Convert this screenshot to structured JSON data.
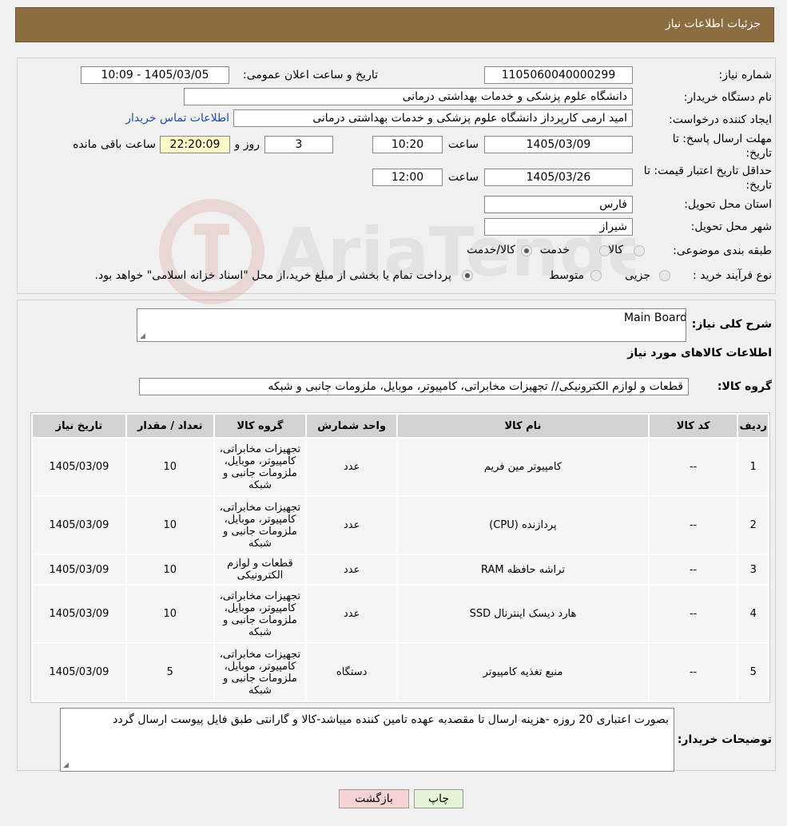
{
  "header": {
    "title": "جزئیات اطلاعات نیاز"
  },
  "details": {
    "need_number_label": "شماره نیاز:",
    "need_number": "1105060040000299",
    "announce_label": "تاریخ و ساعت اعلان عمومی:",
    "announce_value": "1405/03/05 - 10:09",
    "buyer_org_label": "نام دستگاه خریدار:",
    "buyer_org": "دانشگاه علوم پزشکی و خدمات بهداشتی درمانی",
    "creator_label": "ایجاد کننده درخواست:",
    "creator": "امید  ارمی کارپرداز دانشگاه علوم پزشکی و خدمات بهداشتی درمانی",
    "contact_link": "اطلاعات تماس خریدار",
    "deadline_label_1": "مهلت ارسال پاسخ: تا",
    "deadline_label_2": "تاریخ:",
    "deadline_date": "1405/03/09",
    "time_label": "ساعت",
    "deadline_time": "10:20",
    "days": "3",
    "days_label": "روز و",
    "remaining_time": "22:20:09",
    "remaining_label": "ساعت باقی مانده",
    "validity_label_1": "حداقل تاریخ اعتبار قیمت: تا",
    "validity_label_2": "تاریخ:",
    "validity_date": "1405/03/26",
    "validity_time": "12:00",
    "province_label": "استان محل تحویل:",
    "province": "فارس",
    "city_label": "شهر محل تحویل:",
    "city": "شیراز",
    "category_label": "طبقه بندی موضوعی:",
    "category_options": [
      "کالا",
      "خدمت",
      "کالا/خدمت"
    ],
    "process_label": "نوع فرآیند خرید :",
    "process_options": [
      "جزیی",
      "متوسط"
    ],
    "process_note": "پرداخت تمام یا بخشی از مبلغ خرید،از محل \"اسناد خزانه اسلامی\" خواهد بود."
  },
  "summary": {
    "label": "شرح کلی نیاز:",
    "value": "Main Board",
    "goods_info_title": "اطلاعات کالاهای مورد نیاز",
    "group_label": "گروه کالا:",
    "group_value": "قطعات و لوازم الکترونیکی// تجهیزات مخابراتی، کامپیوتر، موبایل، ملزومات جانبی و شبکه"
  },
  "table": {
    "headers": [
      "ردیف",
      "کد کالا",
      "نام کالا",
      "واحد شمارش",
      "گروه کالا",
      "تعداد / مقدار",
      "تاریخ نیاز"
    ],
    "rows": [
      [
        "1",
        "--",
        "کامپیوتر مین فریم",
        "عدد",
        "تجهیزات مخابراتی، کامپیوتر، موبایل، ملزومات جانبی و شبکه",
        "10",
        "1405/03/09"
      ],
      [
        "2",
        "--",
        "پردازنده (CPU)",
        "عدد",
        "تجهیزات مخابراتی، کامپیوتر، موبایل، ملزومات جانبی و شبکه",
        "10",
        "1405/03/09"
      ],
      [
        "3",
        "--",
        "تراشه حافظه RAM",
        "عدد",
        "قطعات و لوازم الکترونیکی",
        "10",
        "1405/03/09"
      ],
      [
        "4",
        "--",
        "هارد دیسک اینترنال SSD",
        "عدد",
        "تجهیزات مخابراتی، کامپیوتر، موبایل، ملزومات جانبی و شبکه",
        "10",
        "1405/03/09"
      ],
      [
        "5",
        "--",
        "منبع تغذیه کامپیوتر",
        "دستگاه",
        "تجهیزات مخابراتی، کامپیوتر، موبایل، ملزومات جانبی و شبکه",
        "5",
        "1405/03/09"
      ]
    ]
  },
  "buyer_notes": {
    "label": "توضیحات خریدار:",
    "value": "بصورت اعتباری 20 روزه -هزینه ارسال تا مقصدبه عهده تامین کننده میباشد-کالا و گارانتی طبق فایل پیوست ارسال گردد"
  },
  "buttons": {
    "print": "چاپ",
    "back": "بازگشت"
  },
  "colors": {
    "header_bg": "#8c6d3f",
    "link": "#1a4fb3",
    "back_button": "#f6d2d2",
    "print_button": "#e3f4d7",
    "remaining_bg": "#fff9c8"
  }
}
